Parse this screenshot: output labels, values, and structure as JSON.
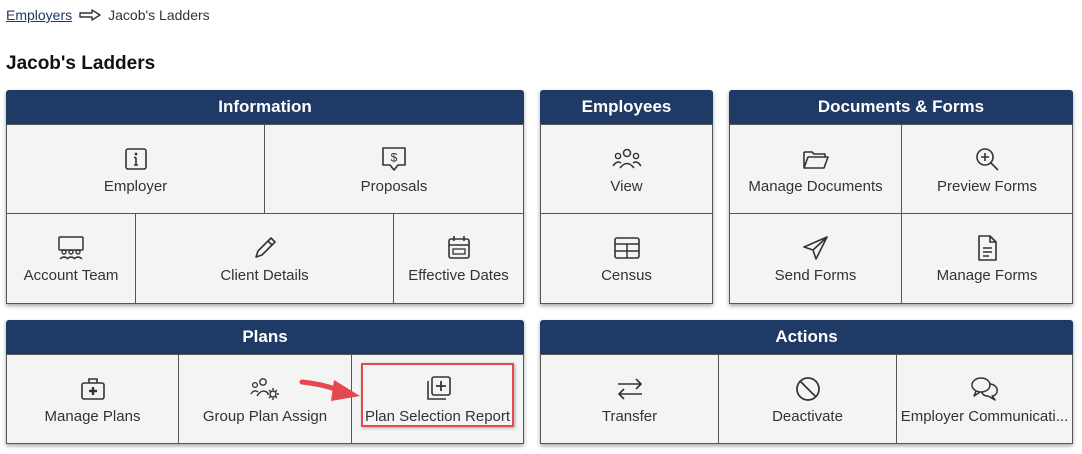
{
  "breadcrumb": {
    "parent": "Employers",
    "current": "Jacob's Ladders"
  },
  "page_title": "Jacob's Ladders",
  "colors": {
    "header": "#1f3a64",
    "highlight": "#e5484d",
    "tile_bg": "#f4f4f4"
  },
  "information": {
    "title": "Information",
    "employer": "Employer",
    "proposals": "Proposals",
    "account_team": "Account Team",
    "client_details": "Client Details",
    "effective_dates": "Effective Dates"
  },
  "employees": {
    "title": "Employees",
    "view": "View",
    "census": "Census"
  },
  "documents": {
    "title": "Documents & Forms",
    "manage_documents": "Manage Documents",
    "preview_forms": "Preview Forms",
    "send_forms": "Send Forms",
    "manage_forms": "Manage Forms"
  },
  "plans": {
    "title": "Plans",
    "manage_plans": "Manage Plans",
    "group_plan_assign": "Group Plan Assign",
    "plan_selection_report": "Plan Selection Report"
  },
  "actions": {
    "title": "Actions",
    "transfer": "Transfer",
    "deactivate": "Deactivate",
    "employer_communications": "Employer Communicati..."
  }
}
